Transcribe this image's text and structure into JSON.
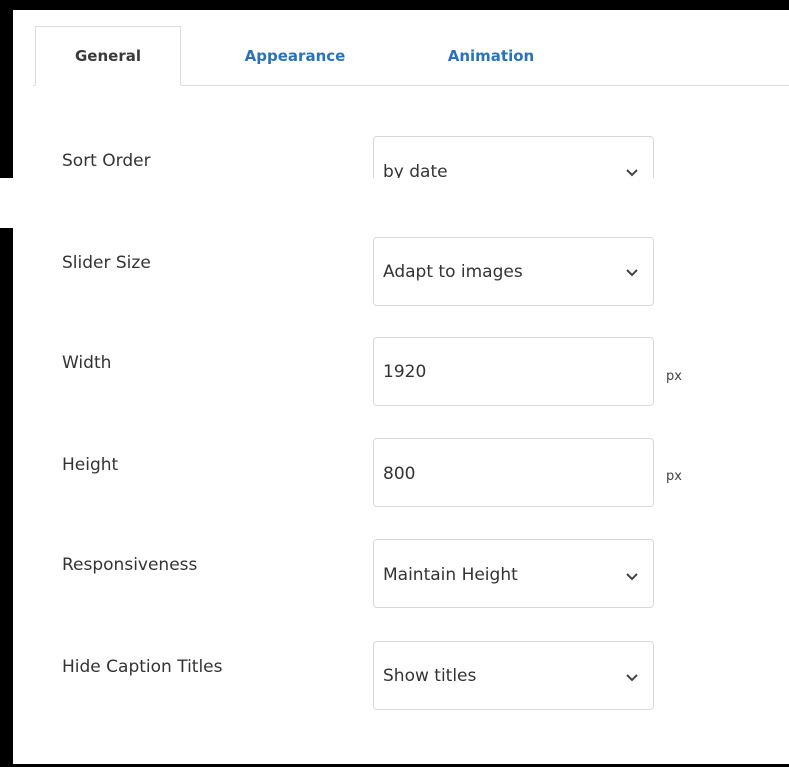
{
  "tabs": [
    {
      "label": "General",
      "active": true
    },
    {
      "label": "Appearance",
      "active": false
    },
    {
      "label": "Animation",
      "active": false
    }
  ],
  "fields": {
    "sort_order": {
      "label": "Sort Order",
      "value": "by date",
      "type": "select"
    },
    "slider_size": {
      "label": "Slider Size",
      "value": "Adapt to images",
      "type": "select"
    },
    "width": {
      "label": "Width",
      "value": "1920",
      "unit": "px",
      "type": "number"
    },
    "height": {
      "label": "Height",
      "value": "800",
      "unit": "px",
      "type": "number"
    },
    "responsiveness": {
      "label": "Responsiveness",
      "value": "Maintain Height",
      "type": "select"
    },
    "hide_caption_titles": {
      "label": "Hide Caption Titles",
      "value": "Show titles",
      "type": "select"
    }
  },
  "icons": {
    "select_indicator": "chevron-down-icon"
  },
  "colors": {
    "tab_link": "#2b73b9",
    "border": "#d6d9dc",
    "text": "#333333"
  }
}
